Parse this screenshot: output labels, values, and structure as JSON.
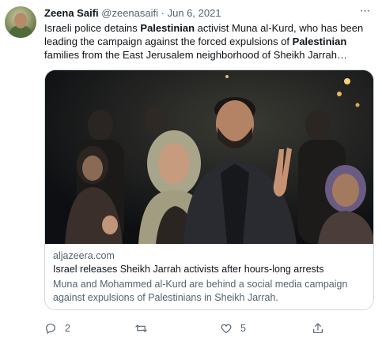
{
  "tweet": {
    "author_name": "Zeena Saifi",
    "author_handle": "@zeenasaifi",
    "separator": "·",
    "date": "Jun 6, 2021",
    "text_parts": [
      "Israeli police detains ",
      "Palestinian",
      " activist Muna al-Kurd, who has been leading the campaign against the forced expulsions of ",
      "Palestinian",
      " families from the East Jerusalem neighborhood of Sheikh Jarrah…"
    ],
    "more_icon": "more-horizontal-icon"
  },
  "card": {
    "domain": "aljazeera.com",
    "title": "Israel releases Sheikh Jarrah activists after hours-long arrests",
    "description": "Muna and Mohammed al-Kurd are behind a social media campaign against expulsions of Palestinians in Sheikh Jarrah."
  },
  "actions": {
    "reply": {
      "icon": "reply-icon",
      "count": "2"
    },
    "retweet": {
      "icon": "retweet-icon",
      "count": ""
    },
    "like": {
      "icon": "heart-icon",
      "count": "5"
    },
    "share": {
      "icon": "share-icon",
      "count": ""
    }
  },
  "colors": {
    "text": "#0f1419",
    "secondary": "#536471",
    "border": "#cfd9de"
  }
}
